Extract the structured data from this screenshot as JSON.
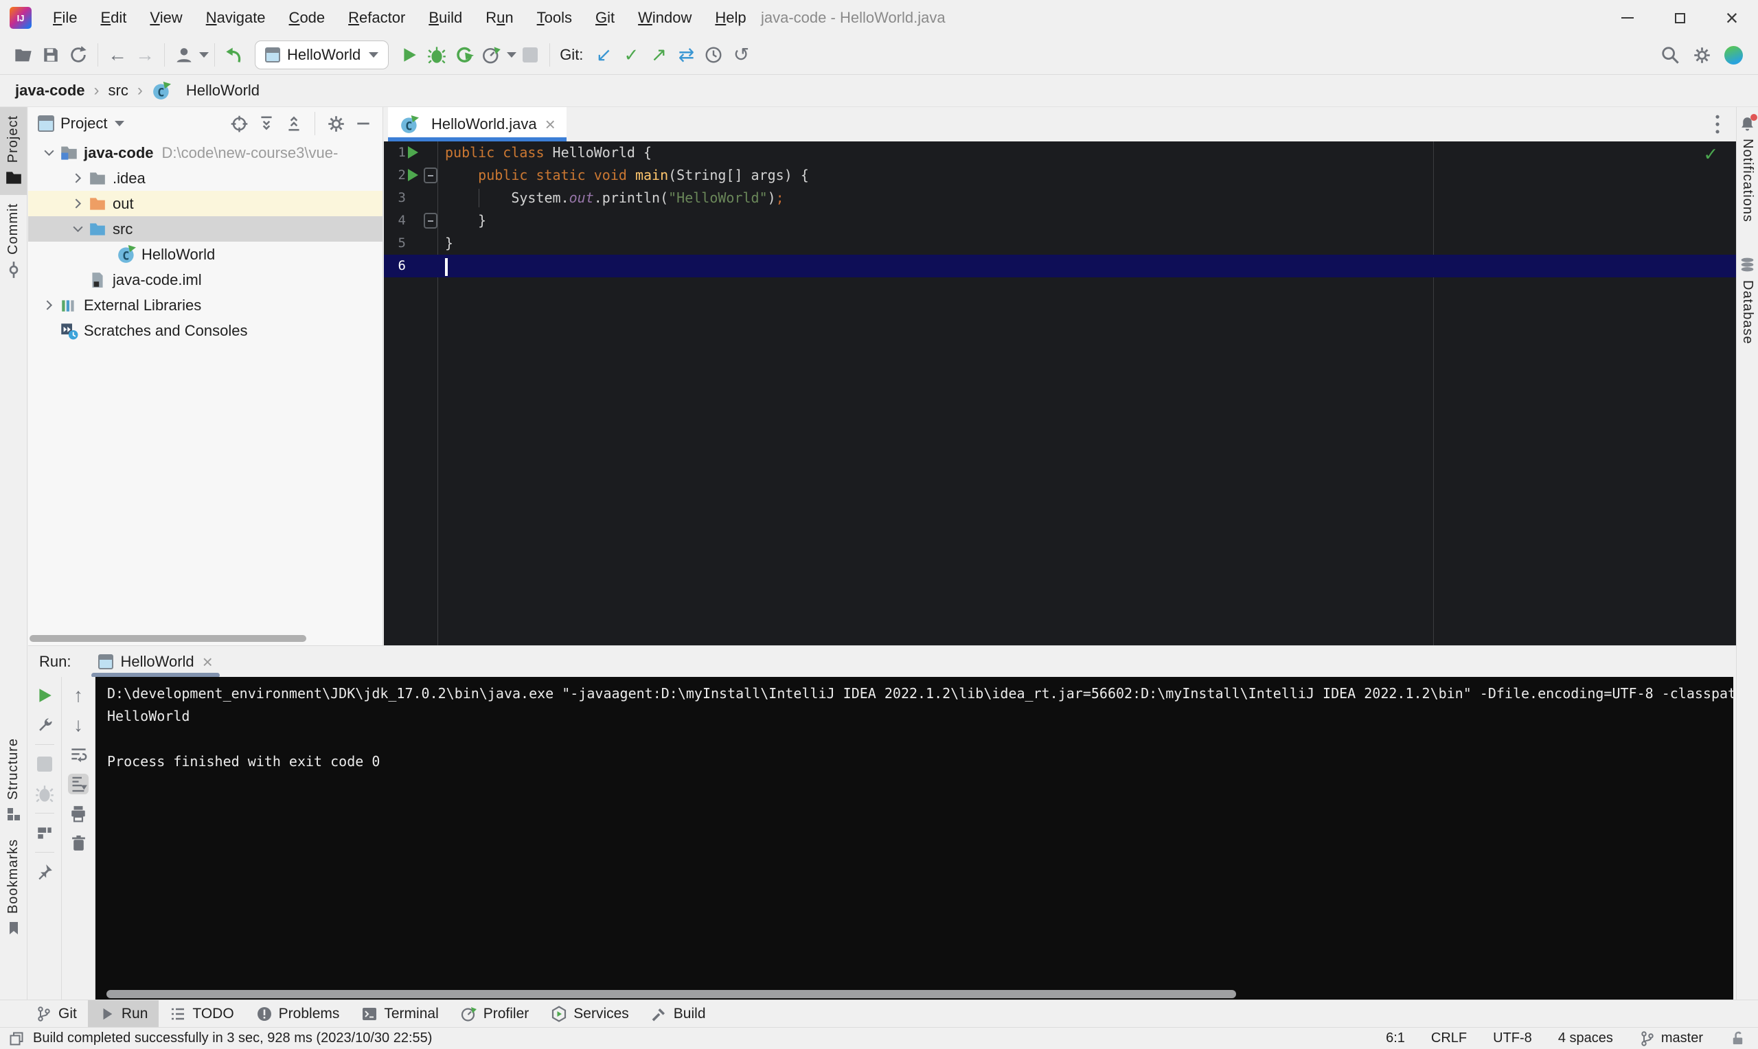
{
  "window": {
    "title": "java-code - HelloWorld.java",
    "menus": [
      {
        "label": "File",
        "accel": 0
      },
      {
        "label": "Edit",
        "accel": 0
      },
      {
        "label": "View",
        "accel": 0
      },
      {
        "label": "Navigate",
        "accel": 0
      },
      {
        "label": "Code",
        "accel": 0
      },
      {
        "label": "Refactor",
        "accel": 0
      },
      {
        "label": "Build",
        "accel": 0
      },
      {
        "label": "Run",
        "accel": 1
      },
      {
        "label": "Tools",
        "accel": 0
      },
      {
        "label": "Git",
        "accel": 0
      },
      {
        "label": "Window",
        "accel": 0
      },
      {
        "label": "Help",
        "accel": 0
      }
    ]
  },
  "toolbar": {
    "run_config": "HelloWorld",
    "git_label": "Git:"
  },
  "breadcrumbs": [
    "java-code",
    "src",
    "HelloWorld"
  ],
  "left_stripe": {
    "top": [
      {
        "label": "Project",
        "icon": "project-folder",
        "selected": true
      },
      {
        "label": "Commit",
        "icon": "commit-node",
        "selected": false
      }
    ],
    "bottom": [
      {
        "label": "Structure",
        "icon": "structure-blocks",
        "selected": false
      },
      {
        "label": "Bookmarks",
        "icon": "bookmark-flag",
        "selected": false
      }
    ]
  },
  "right_stripe": {
    "items": [
      {
        "label": "Notifications",
        "icon": "bell",
        "badge": true
      },
      {
        "label": "Database",
        "icon": "database",
        "badge": false
      }
    ]
  },
  "project_panel": {
    "title": "Project",
    "tree": [
      {
        "level": 0,
        "chevron": "down",
        "icon": "project-folder-badge",
        "label": "java-code",
        "detail": "D:\\code\\new-course3\\vue-",
        "bold": true,
        "highlight": null
      },
      {
        "level": 1,
        "chevron": "right",
        "icon": "folder-gray",
        "label": ".idea",
        "detail": "",
        "bold": false,
        "highlight": null
      },
      {
        "level": 1,
        "chevron": "right",
        "icon": "folder-orange",
        "label": "out",
        "detail": "",
        "bold": false,
        "highlight": "yellow"
      },
      {
        "level": 1,
        "chevron": "down",
        "icon": "folder-blue",
        "label": "src",
        "detail": "",
        "bold": false,
        "highlight": "selected"
      },
      {
        "level": 2,
        "chevron": null,
        "icon": "java-class",
        "label": "HelloWorld",
        "detail": "",
        "bold": false,
        "highlight": null
      },
      {
        "level": 1,
        "chevron": null,
        "icon": "iml-file",
        "label": "java-code.iml",
        "detail": "",
        "bold": false,
        "highlight": null
      },
      {
        "level": 0,
        "chevron": "right",
        "icon": "ext-libs",
        "label": "External Libraries",
        "detail": "",
        "bold": false,
        "highlight": null
      },
      {
        "level": 0,
        "chevron": null,
        "icon": "scratches",
        "label": "Scratches and Consoles",
        "detail": "",
        "bold": false,
        "highlight": null
      }
    ]
  },
  "editor": {
    "tab": {
      "label": "HelloWorld.java",
      "icon": "java-class"
    },
    "active_line": 6,
    "lines": [
      {
        "num": 1,
        "run": true,
        "fold": null,
        "tokens": [
          {
            "t": "public class ",
            "c": "kw"
          },
          {
            "t": "HelloWorld {",
            "c": "pl"
          }
        ]
      },
      {
        "num": 2,
        "run": true,
        "fold": "start",
        "tokens": [
          {
            "t": "    ",
            "c": "pl"
          },
          {
            "t": "public static void ",
            "c": "kw"
          },
          {
            "t": "main",
            "c": "fn"
          },
          {
            "t": "(String[] args) {",
            "c": "pl"
          }
        ]
      },
      {
        "num": 3,
        "run": false,
        "fold": null,
        "tokens": [
          {
            "t": "        System.",
            "c": "pl"
          },
          {
            "t": "out",
            "c": "field"
          },
          {
            "t": ".println(",
            "c": "pl"
          },
          {
            "t": "\"HelloWorld\"",
            "c": "str"
          },
          {
            "t": ")",
            "c": "pl"
          },
          {
            "t": ";",
            "c": "semi"
          }
        ]
      },
      {
        "num": 4,
        "run": false,
        "fold": "end",
        "tokens": [
          {
            "t": "    }",
            "c": "pl"
          }
        ]
      },
      {
        "num": 5,
        "run": false,
        "fold": null,
        "tokens": [
          {
            "t": "}",
            "c": "pl"
          }
        ]
      },
      {
        "num": 6,
        "run": false,
        "fold": null,
        "tokens": []
      }
    ]
  },
  "run_panel": {
    "label": "Run:",
    "tab": {
      "label": "HelloWorld",
      "icon": "app-window"
    },
    "console_lines": [
      "D:\\development_environment\\JDK\\jdk_17.0.2\\bin\\java.exe \"-javaagent:D:\\myInstall\\IntelliJ IDEA 2022.1.2\\lib\\idea_rt.jar=56602:D:\\myInstall\\IntelliJ IDEA 2022.1.2\\bin\" -Dfile.encoding=UTF-8 -classpat",
      "HelloWorld",
      "",
      "Process finished with exit code 0"
    ]
  },
  "bottom_bar": [
    {
      "label": "Git",
      "icon": "git-branch",
      "selected": false
    },
    {
      "label": "Run",
      "icon": "play-small",
      "selected": true
    },
    {
      "label": "TODO",
      "icon": "todo-list",
      "selected": false
    },
    {
      "label": "Problems",
      "icon": "problems",
      "selected": false
    },
    {
      "label": "Terminal",
      "icon": "terminal",
      "selected": false
    },
    {
      "label": "Profiler",
      "icon": "profiler",
      "selected": false
    },
    {
      "label": "Services",
      "icon": "services",
      "selected": false
    },
    {
      "label": "Build",
      "icon": "build-hammer",
      "selected": false
    }
  ],
  "status_bar": {
    "message": "Build completed successfully in 3 sec, 928 ms (2023/10/30 22:55)",
    "caret_position": "6:1",
    "line_separator": "CRLF",
    "encoding": "UTF-8",
    "indent": "4 spaces",
    "branch": "master"
  },
  "colors": {
    "accent_blue": "#3C7ED6",
    "run_green": "#4EA84E",
    "git_blue": "#3B97D3",
    "keyword_orange": "#CC7832",
    "method_yellow": "#FFC66D",
    "field_purple": "#9876AA",
    "string_green": "#6A8759",
    "editor_bg": "#1B1C1F",
    "console_bg": "#0D0D0D",
    "active_line_bg": "#0E0E57",
    "chrome_bg": "#F0F0F0"
  }
}
